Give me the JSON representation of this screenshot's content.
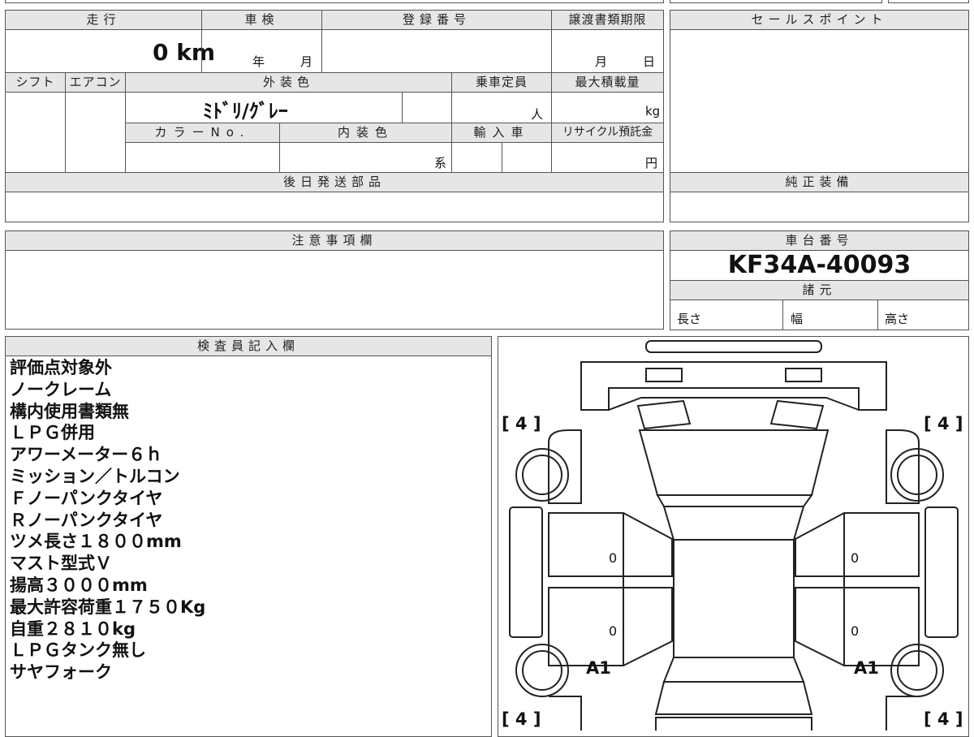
{
  "header": {
    "mileage_label": "走行",
    "inspection_label": "車検",
    "registration_label": "登録番号",
    "transfer_deadline_label": "譲渡書類期限",
    "sales_point_label": "セールスポイント"
  },
  "values": {
    "mileage": "0 km",
    "year_unit": "年",
    "month_unit": "月",
    "transfer_month_unit": "月",
    "transfer_day_unit": "日"
  },
  "row2": {
    "shift_label": "シフト",
    "aircon_label": "エアコン",
    "exterior_color_label": "外装色",
    "capacity_label": "乗車定員",
    "max_load_label": "最大積載量",
    "exterior_color_value": "ﾐﾄﾞﾘ/ｸﾞﾚｰ",
    "capacity_unit": "人",
    "max_load_unit": "kg",
    "color_no_label": "カラーNo.",
    "interior_color_label": "内装色",
    "import_label": "輸入車",
    "recycle_label": "リサイクル預託金",
    "interior_unit": "系",
    "recycle_unit": "円"
  },
  "sections": {
    "later_parts_label": "後日発送部品",
    "genuine_equipment_label": "純正装備",
    "caution_label": "注意事項欄",
    "chassis_number_label": "車台番号",
    "chassis_number": "KF34A-40093",
    "specs_label": "諸元",
    "length_label": "長さ",
    "width_label": "幅",
    "height_label": "高さ",
    "inspector_label": "検査員記入欄"
  },
  "inspector_notes": [
    "評価点対象外",
    "ノークレーム",
    "構内使用書類無",
    "ＬＰＧ併用",
    "アワーメーター６ｈ",
    "ミッション／トルコン",
    "Ｆノーパンクタイヤ",
    "Ｒノーパンクタイヤ",
    "ツメ長さ１８００mm",
    "マスト型式Ｖ",
    "揚高３０００mm",
    "最大許容荷重１７５０Kg",
    "自重２８１０kg",
    "ＬＰＧタンク無し",
    "サヤフォーク"
  ],
  "diagram": {
    "tire_front_left": "[ 4 ]",
    "tire_front_right": "[ 4 ]",
    "tire_rear_left": "[ 4 ]",
    "tire_rear_right": "[ 4 ]",
    "door_zero_1": "0",
    "door_zero_2": "0",
    "door_zero_3": "0",
    "door_zero_4": "0",
    "mark_left": "A1",
    "mark_right": "A1"
  }
}
